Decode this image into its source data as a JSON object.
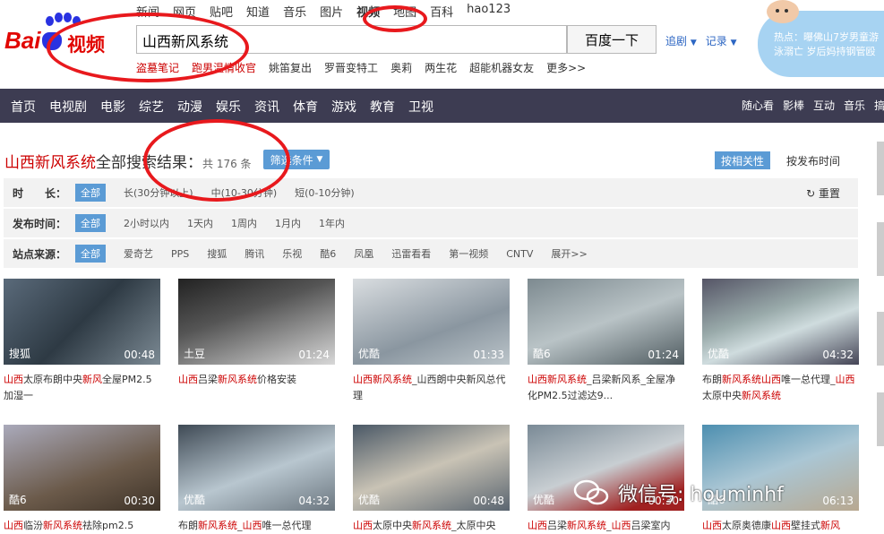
{
  "header": {
    "nav": [
      "新闻",
      "网页",
      "贴吧",
      "知道",
      "音乐",
      "图片",
      "视频",
      "地图",
      "百科",
      "hao123"
    ],
    "logo_bai": "Bai",
    "logo_du": "du",
    "logo_video": "视频",
    "search_value": "山西新风系统",
    "search_button": "百度一下",
    "link_follow": "追剧",
    "link_history": "记录",
    "hot_words": [
      "盗墓笔记",
      "跑男温情收官",
      "姚笛复出",
      "罗晋变特工",
      "奥莉",
      "两生花",
      "超能机器女友",
      "更多>>"
    ],
    "hot_label": "热点：",
    "hot_text": "曝佛山7岁男童游泳溺亡 岁后妈持钢管殴"
  },
  "main_nav": {
    "left": [
      "首页",
      "电视剧",
      "电影",
      "综艺",
      "动漫",
      "娱乐",
      "资讯",
      "体育",
      "游戏",
      "教育",
      "卫视"
    ],
    "right": [
      "随心看",
      "影棒",
      "互动",
      "音乐",
      "搞笑"
    ]
  },
  "results": {
    "query": "山西新风系统",
    "title_suffix": "全部搜索结果：",
    "count": "共 176 条",
    "filter_button": "筛选条件",
    "sort_relevance": "按相关性",
    "sort_time": "按发布时间"
  },
  "filters": [
    {
      "label": "时　　长：",
      "options": [
        "全部",
        "长(30分钟以上)",
        "中(10-30分钟)",
        "短(0-10分钟)"
      ],
      "reset": "重置"
    },
    {
      "label": "发布时间：",
      "options": [
        "全部",
        "2小时以内",
        "1天内",
        "1周内",
        "1月内",
        "1年内"
      ]
    },
    {
      "label": "站点来源：",
      "options": [
        "全部",
        "爱奇艺",
        "PPS",
        "搜狐",
        "腾讯",
        "乐视",
        "酷6",
        "凤凰",
        "迅雷看看",
        "第一视频",
        "CNTV",
        "展开>>"
      ]
    }
  ],
  "videos": [
    {
      "source": "搜狐",
      "duration": "00:48",
      "title_parts": [
        [
          "山西",
          "r"
        ],
        [
          "太原布朗中央",
          ""
        ],
        [
          "新风",
          "r"
        ],
        [
          "全屋PM2.5加湿一",
          ""
        ]
      ]
    },
    {
      "source": "土豆",
      "duration": "01:24",
      "title_parts": [
        [
          "山西",
          "r"
        ],
        [
          "吕梁",
          ""
        ],
        [
          "新风系统",
          "r"
        ],
        [
          "价格安装",
          ""
        ]
      ]
    },
    {
      "source": "优酷",
      "duration": "01:33",
      "title_parts": [
        [
          "山西新风系统",
          "r"
        ],
        [
          "_山西朗中央新风总代理",
          ""
        ]
      ]
    },
    {
      "source": "酷6",
      "duration": "01:24",
      "title_parts": [
        [
          "山西新风系统",
          "r"
        ],
        [
          "_吕梁新风系_全屋净化PM2.5过滤达9...",
          ""
        ]
      ]
    },
    {
      "source": "优酷",
      "duration": "04:32",
      "title_parts": [
        [
          "布朗",
          ""
        ],
        [
          "新风系统",
          "r"
        ],
        [
          "山西",
          "r"
        ],
        [
          "唯一总代理_",
          ""
        ],
        [
          "山西",
          "r"
        ],
        [
          "太原中央",
          ""
        ],
        [
          "新风系统",
          "r"
        ]
      ]
    },
    {
      "source": "酷6",
      "duration": "00:30",
      "title_parts": [
        [
          "山西",
          "r"
        ],
        [
          "临汾",
          ""
        ],
        [
          "新风系统",
          "r"
        ],
        [
          "祛除pm2.5",
          ""
        ]
      ]
    },
    {
      "source": "优酷",
      "duration": "04:32",
      "title_parts": [
        [
          "布朗",
          ""
        ],
        [
          "新风系统",
          "r"
        ],
        [
          "_",
          ""
        ],
        [
          "山西",
          "r"
        ],
        [
          "唯一总代理",
          ""
        ]
      ]
    },
    {
      "source": "优酷",
      "duration": "00:48",
      "title_parts": [
        [
          "山西",
          "r"
        ],
        [
          "太原中央",
          ""
        ],
        [
          "新风系统",
          "r"
        ],
        [
          "_太原中央",
          ""
        ]
      ]
    },
    {
      "source": "优酷",
      "duration": "00:30",
      "title_parts": [
        [
          "山西",
          "r"
        ],
        [
          "吕梁",
          ""
        ],
        [
          "新风系统",
          "r"
        ],
        [
          "_",
          ""
        ],
        [
          "山西",
          "r"
        ],
        [
          "吕梁室内",
          ""
        ]
      ]
    },
    {
      "source": "酷6",
      "duration": "06:13",
      "title_parts": [
        [
          "山西",
          "r"
        ],
        [
          "太原奥德康",
          ""
        ],
        [
          "山西",
          "r"
        ],
        [
          "壁挂式",
          ""
        ],
        [
          "新风",
          "r"
        ]
      ]
    }
  ],
  "watermark": "微信号: houminhf",
  "colors": {
    "nav_bg": "#3d3c52",
    "accent_blue": "#5b9bd5",
    "highlight_red": "#cc0000",
    "annotation_red": "#e8191d"
  }
}
